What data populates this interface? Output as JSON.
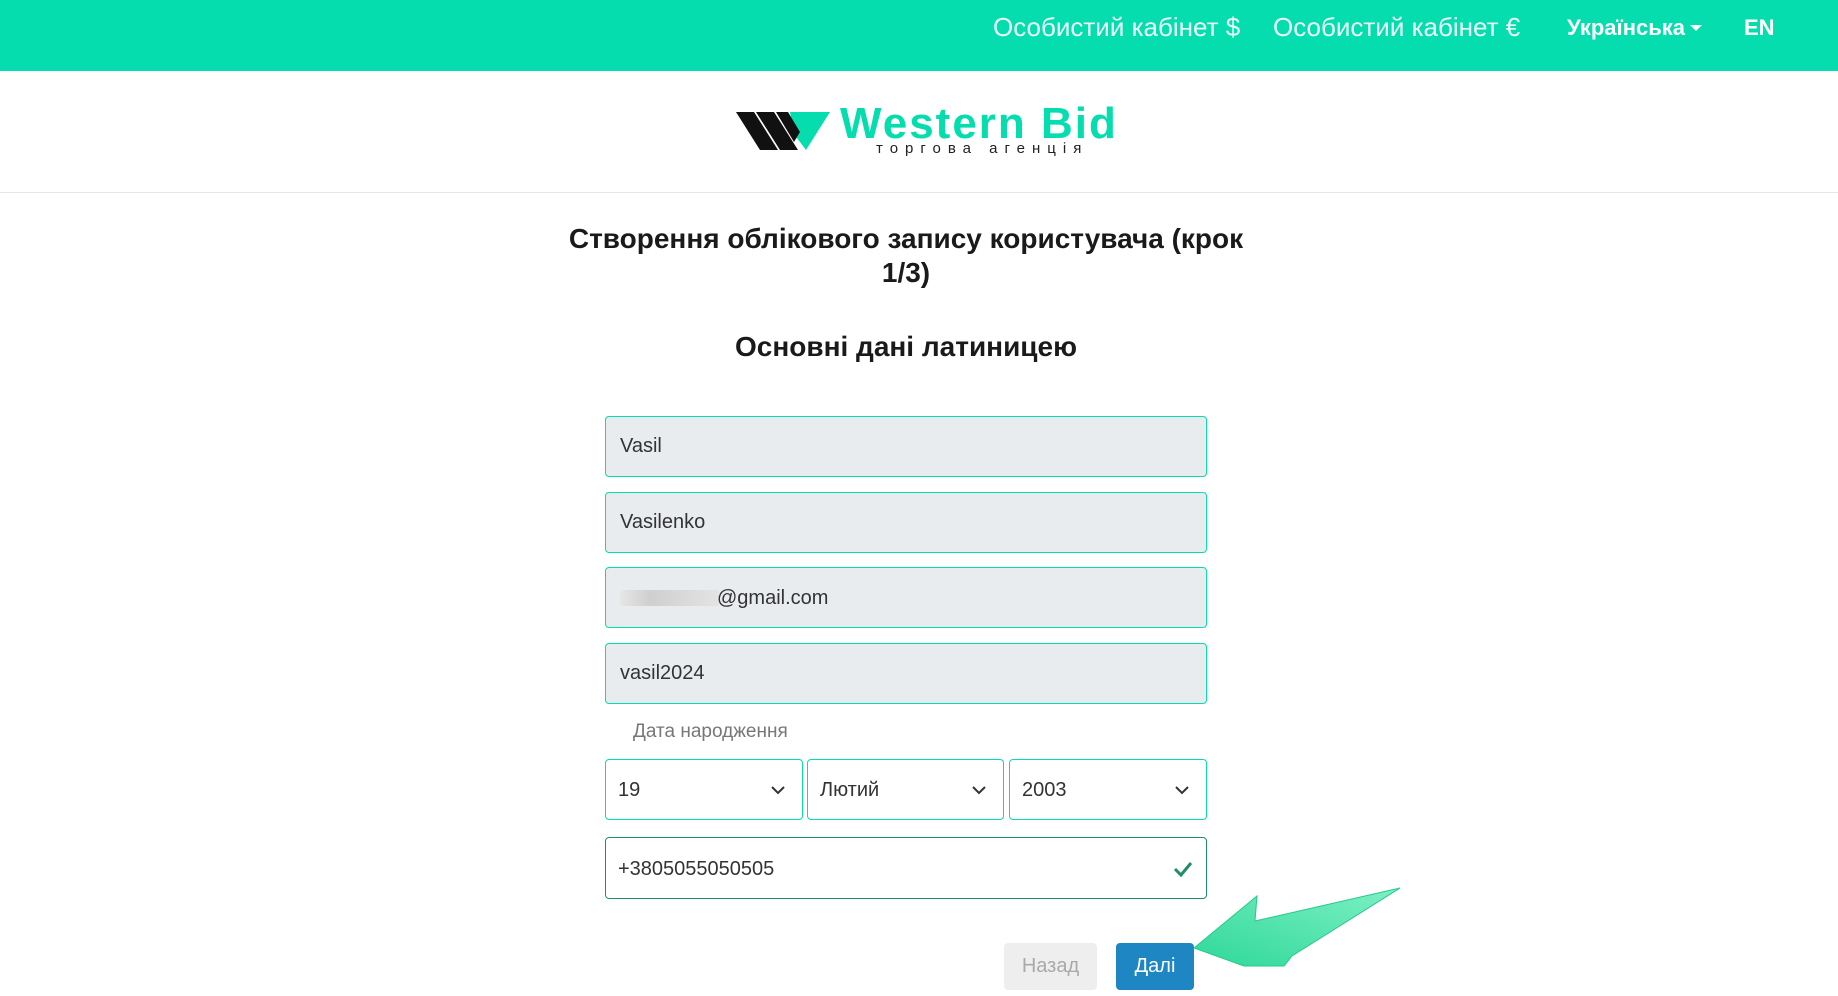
{
  "topbar": {
    "cabinet_usd": "Особистий кабінет $",
    "cabinet_eur": "Особистий кабінет €",
    "language": "Українська",
    "lang_alt": "EN",
    "bg_color": "#05ddae"
  },
  "header": {
    "logo_title": "Western Bid",
    "logo_subtitle": "торгова агенція",
    "logo_icon": "western-bid-logo-mark"
  },
  "form": {
    "title": "Створення облікового запису користувача (крок 1/3)",
    "subtitle": "Основні дані латиницею",
    "first_name": "Vasil",
    "last_name": "Vasilenko",
    "email_visible": "@gmail.com",
    "username": "vasil2024",
    "dob_label": "Дата народження",
    "dob_day": "19",
    "dob_month": "Лютий",
    "dob_year": "2003",
    "phone": "+3805055050505",
    "back_label": "Назад",
    "next_label": "Далі"
  },
  "colors": {
    "accent": "#05ddae",
    "primary_button": "#1d86c3",
    "arrow": "#3de0a4"
  }
}
